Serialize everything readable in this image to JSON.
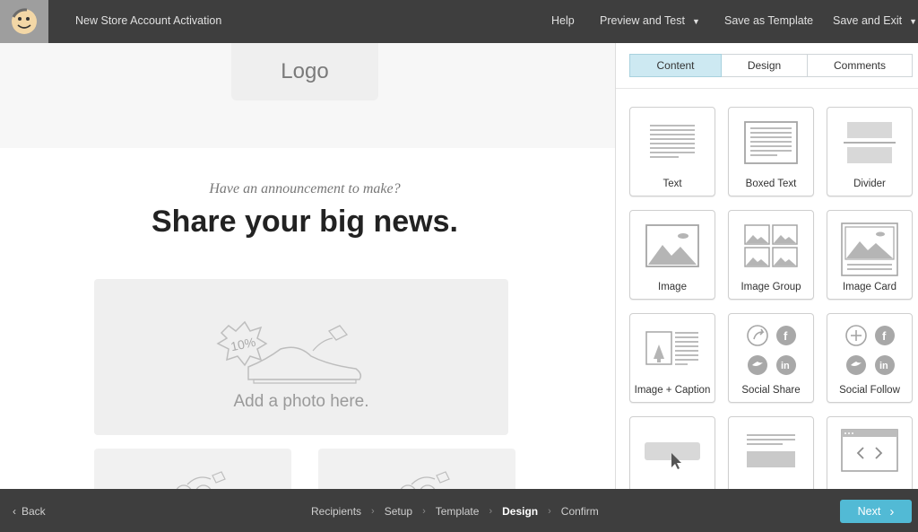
{
  "topbar": {
    "campaign_title": "New Store Account Activation",
    "help": "Help",
    "preview": "Preview and Test",
    "save_template": "Save as Template",
    "save_exit": "Save and Exit"
  },
  "canvas": {
    "logo_placeholder": "Logo",
    "announcement": "Have an announcement to make?",
    "headline": "Share your big news.",
    "photo_prompt": "Add a photo here.",
    "photo_badge": "10%"
  },
  "panel": {
    "tabs": [
      "Content",
      "Design",
      "Comments"
    ],
    "active_tab": "Content",
    "blocks": [
      "Text",
      "Boxed Text",
      "Divider",
      "Image",
      "Image Group",
      "Image Card",
      "Image + Caption",
      "Social Share",
      "Social Follow",
      "",
      "",
      ""
    ]
  },
  "footer": {
    "back": "Back",
    "steps": [
      "Recipients",
      "Setup",
      "Template",
      "Design",
      "Confirm"
    ],
    "current_step": "Design",
    "next": "Next"
  },
  "colors": {
    "topbar": "#3e3e3e",
    "active_tab": "#cde9f2",
    "next_button": "#52bad5"
  }
}
